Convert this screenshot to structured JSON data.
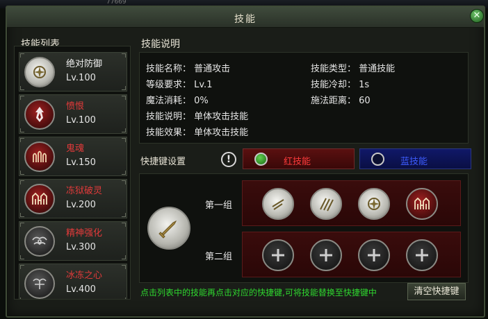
{
  "background_counter": "77669",
  "window": {
    "title": "技能",
    "close_icon": "close-icon"
  },
  "skill_list": {
    "heading": "技能列表",
    "items": [
      {
        "name": "绝对防御",
        "level": "Lv.100",
        "name_color": "#f0f0f0",
        "icon": "shield-orb-icon"
      },
      {
        "name": "愤恨",
        "level": "Lv.100",
        "name_color": "#e23a3a",
        "icon": "flame-emblem-icon"
      },
      {
        "name": "鬼魂",
        "level": "Lv.150",
        "name_color": "#e23a3a",
        "icon": "ghosts-icon"
      },
      {
        "name": "冻狱破灵",
        "level": "Lv.200",
        "name_color": "#e23a3a",
        "icon": "spirit-cage-icon"
      },
      {
        "name": "精神强化",
        "level": "Lv.300",
        "name_color": "#e23a3a",
        "icon": "mind-emblem-icon"
      },
      {
        "name": "冰冻之心",
        "level": "Lv.400",
        "name_color": "#e23a3a",
        "icon": "frozen-heart-icon"
      }
    ]
  },
  "skill_info": {
    "heading": "技能说明",
    "rows": {
      "name": "技能名称： 普通攻击",
      "level_req": "等级要求： Lv.1",
      "mana": "魔法消耗： 0%",
      "description": "技能说明： 单体攻击技能",
      "effect": "技能效果： 单体攻击技能",
      "type": "技能类型： 普通技能",
      "cooldown": "技能冷却： 1s",
      "range": "施法距离： 60"
    }
  },
  "hotkeys": {
    "label": "快捷键设置",
    "warning_icon": "info-icon",
    "tabs": {
      "red": "红技能",
      "blue": "蓝技能"
    },
    "selected_skill_icon": "sword-icon",
    "groups": [
      {
        "label": "第一组",
        "slots": [
          "slash-icon",
          "claw-icon",
          "shield-orb-icon",
          "spirit-cage-icon"
        ]
      },
      {
        "label": "第二组",
        "slots": [
          "plus-icon",
          "plus-icon",
          "plus-icon",
          "plus-icon"
        ]
      }
    ],
    "hint": "点击列表中的技能再点击对应的快捷键,可将技能替换至快捷键中",
    "clear_button": "清空快捷键"
  },
  "colors": {
    "accent_green": "#2fd82f",
    "red_skill": "#ff3b3b",
    "blue_skill": "#3d5cff"
  }
}
